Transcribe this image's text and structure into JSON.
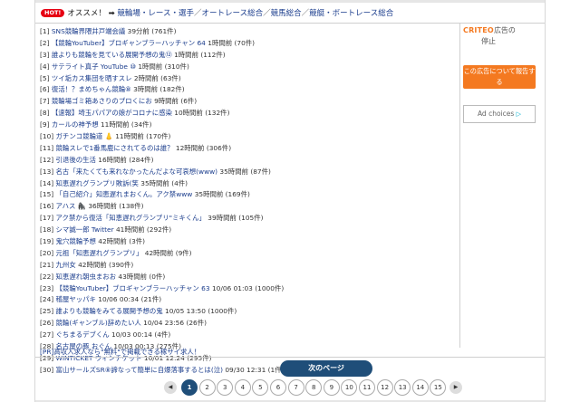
{
  "header": {
    "hot_badge": "HOT!",
    "label": "オススメ！",
    "arrow": "➡",
    "links": [
      "競輪場・レース・選手",
      "オートレース総合",
      "競馬総合",
      "競艇・ボートレース総合"
    ],
    "separator": "／"
  },
  "threads": [
    {
      "num": "[1]",
      "title": "SNS競輪界隈井戸端会議",
      "time": "39分前",
      "count": "(761件)"
    },
    {
      "num": "[2]",
      "title": "【競輪YouTuber】ブロギャンブラーハッチャン 64",
      "time": "1時間前",
      "count": "(70件)"
    },
    {
      "num": "[3]",
      "title": "誰よりも競輪を見ている展開予想の鬼⑫",
      "time": "1時間前",
      "count": "(112件)"
    },
    {
      "num": "[4]",
      "title": "サテライト真子 YouTube ⑩",
      "time": "1時間前",
      "count": "(310件)"
    },
    {
      "num": "[5]",
      "title": "ツイ垢カス集団を晒すスレ",
      "time": "2時間前",
      "count": "(63件)"
    },
    {
      "num": "[6]",
      "title": "復活！？まめちゃん競輪⑧",
      "time": "3時間前",
      "count": "(182件)"
    },
    {
      "num": "[7]",
      "title": "競輪場ゴミ箱あさりのプロくにお",
      "time": "9時間前",
      "count": "(6件)"
    },
    {
      "num": "[8]",
      "title": "【速報】埼玉パパアの娘がコロナに感染",
      "time": "10時間前",
      "count": "(132件)"
    },
    {
      "num": "[9]",
      "title": "カールの神予想",
      "time": "11時間前",
      "count": "(34件)"
    },
    {
      "num": "[10]",
      "title": "ガチンコ競輪道 👃",
      "time": "11時間前",
      "count": "(170件)"
    },
    {
      "num": "[11]",
      "title": "競輪スレで1番馬鹿にされてるのは誰？",
      "time": "12時間前",
      "count": "(306件)"
    },
    {
      "num": "[12]",
      "title": "引退後の生活",
      "time": "16時間前",
      "count": "(284件)"
    },
    {
      "num": "[13]",
      "title": "名古「来たくても来れなかったんだよな可哀想(www)",
      "time": "35時間前",
      "count": "(87件)"
    },
    {
      "num": "[14]",
      "title": "知恵遅れグランプリ敗訴(笑",
      "time": "35時間前",
      "count": "(4件)"
    },
    {
      "num": "[15]",
      "title": "「自己紹介」知恵遅れまおくん。アク禁www",
      "time": "35時間前",
      "count": "(169件)"
    },
    {
      "num": "[16]",
      "title": "アハス 🦍",
      "time": "36時間前",
      "count": "(138件)"
    },
    {
      "num": "[17]",
      "title": "アク禁から復活「知恵遅れグランプリ\"ミキくん」",
      "time": "39時間前",
      "count": "(105件)"
    },
    {
      "num": "[18]",
      "title": "シマ誠一郎 Twitter",
      "time": "41時間前",
      "count": "(292件)"
    },
    {
      "num": "[19]",
      "title": "鬼穴競輪予想",
      "time": "42時間前",
      "count": "(3件)"
    },
    {
      "num": "[20]",
      "title": "元祖「知恵遅れグランプリ」",
      "time": "42時間前",
      "count": "(9件)"
    },
    {
      "num": "[21]",
      "title": "九州女",
      "time": "42時間前",
      "count": "(390件)"
    },
    {
      "num": "[22]",
      "title": "知恵遅れ朝虫まおお",
      "time": "43時間前",
      "count": "(0件)"
    },
    {
      "num": "[23]",
      "title": "【競輪YouTuber】ブロギャンブラーハッチャン 63",
      "time": "10/06 01:03",
      "count": "(1000件)"
    },
    {
      "num": "[24]",
      "title": "稽屋ヤッパキ",
      "time": "10/06 00:34",
      "count": "(21件)"
    },
    {
      "num": "[25]",
      "title": "誰よりも競輪をみてる展開予想の鬼",
      "time": "10/05 13:50",
      "count": "(1000件)"
    },
    {
      "num": "[26]",
      "title": "競輪(ギャンブル)辞めたい人",
      "time": "10/04 23:56",
      "count": "(26件)"
    },
    {
      "num": "[27]",
      "title": "ぐちまるデブくん",
      "time": "10/03 00:14",
      "count": "(4件)"
    },
    {
      "num": "[28]",
      "title": "名古屋の豚 おぐん",
      "time": "10/03 00:13",
      "count": "(275件)"
    },
    {
      "num": "[29]",
      "title": "WINTICKET ウィンチケット",
      "time": "10/01 12:24",
      "count": "(295件)"
    },
    {
      "num": "[30]",
      "title": "富山サールズSR⑧諦なって簡単に自爆落事するとは(泣)",
      "time": "09/30 12:31",
      "count": "(1件)"
    }
  ],
  "pr": {
    "text": "[PR]高収入求人なら\"無料\"で掲載できる稼サイ求人！"
  },
  "ad": {
    "brand": "CRITEO",
    "head_suffix": "広告の",
    "stop": "停止",
    "button": "この広告について報告する",
    "choices": "Ad choices",
    "choices_icon": "▷"
  },
  "pagination": {
    "next_label": "次のページ",
    "prev_icon": "◀",
    "next_icon": "▶",
    "pages": [
      "1",
      "2",
      "3",
      "4",
      "5",
      "6",
      "7",
      "8",
      "9",
      "10",
      "11",
      "12",
      "13",
      "14",
      "15"
    ],
    "current": "1"
  },
  "colors": {
    "link": "#1a3c8c",
    "hot_badge": "#e60012",
    "ad_accent": "#f47920",
    "next_button": "#1f4e79"
  }
}
